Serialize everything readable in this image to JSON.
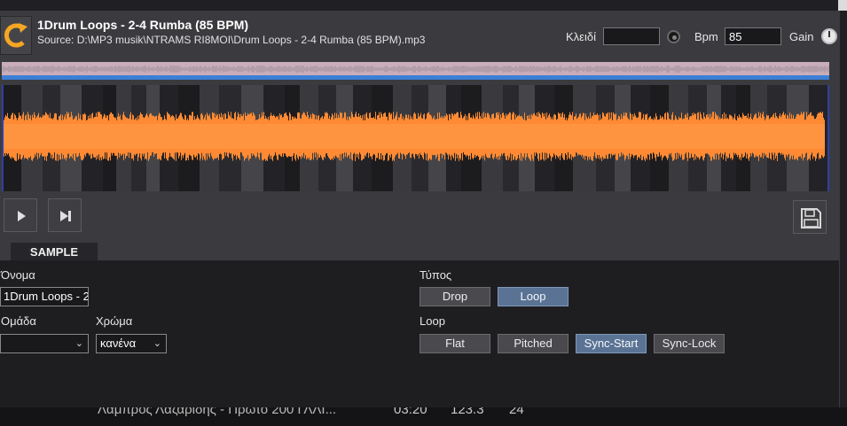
{
  "header": {
    "title": "1Drum Loops - 2-4 Rumba (85 BPM)",
    "source": "Source: D:\\MP3 musik\\NTRAMS RI8MOI\\Drum Loops - 2-4 Rumba (85 BPM).mp3",
    "key_label": "Κλειδί",
    "key_value": "",
    "bpm_label": "Bpm",
    "bpm_value": "85",
    "gain_label": "Gain"
  },
  "sample_tab": {
    "label": "SAMPLE"
  },
  "form": {
    "name_label": "Όνομα",
    "name_value": "1Drum Loops - 2",
    "group_label": "Ομάδα",
    "group_value": "",
    "color_label": "Χρώμα",
    "color_value": "κανένα",
    "type_label": "Τύπος",
    "type_options": [
      {
        "label": "Drop",
        "active": false
      },
      {
        "label": "Loop",
        "active": true
      }
    ],
    "loop_label": "Loop",
    "loop_options": [
      {
        "label": "Flat",
        "active": false
      },
      {
        "label": "Pitched",
        "active": false
      },
      {
        "label": "Sync-Start",
        "active": true
      },
      {
        "label": "Sync-Lock",
        "active": false
      }
    ]
  },
  "background_row": {
    "title": "Λάμπρος Λαζαρίδης - Πρώτο 200 ΓΛΛΙ...",
    "time": "03:20",
    "bpm": "123.3",
    "number": "24"
  },
  "icons": {
    "logo": "refresh-c-logo-icon",
    "play": "play-icon",
    "next": "skip-next-icon",
    "save": "floppy-save-icon",
    "key_knob": "key-knob-icon",
    "gain_knob": "gain-knob-icon"
  },
  "colors": {
    "accent": "#f5a623",
    "waveform": "#ff8a33",
    "overview_bar": "#3b7fd6",
    "active_button": "#5a7394",
    "panel": "#3b3b3f",
    "content_bg": "#1e1e21"
  }
}
